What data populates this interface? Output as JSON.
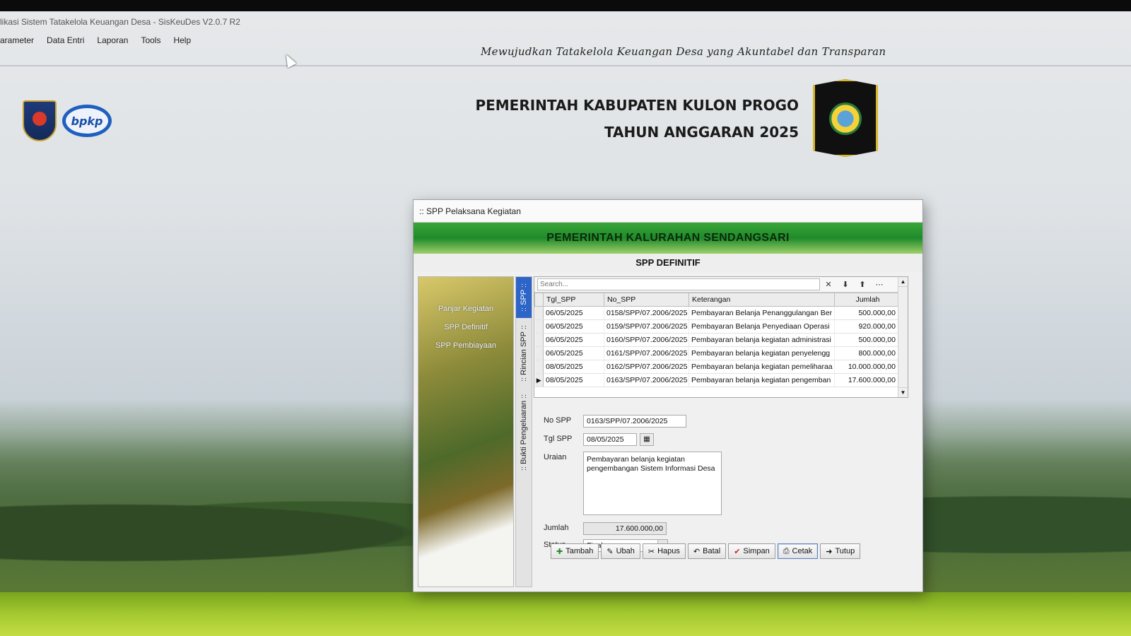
{
  "app": {
    "title": "likasi Sistem Tatakelola Keuangan Desa - SisKeuDes V2.0.7 R2",
    "menu": [
      "arameter",
      "Data Entri",
      "Laporan",
      "Tools",
      "Help"
    ],
    "motto": "Mewujudkan Tatakelola Keuangan Desa yang Akuntabel dan Transparan",
    "header_line1": "PEMERINTAH KABUPATEN KULON PROGO",
    "header_line2": "TAHUN ANGGARAN 2025",
    "bpkp_logo_text": "bpkp"
  },
  "window": {
    "title": ":: SPP Pelaksana Kegiatan",
    "banner": "PEMERINTAH KALURAHAN SENDANGSARI",
    "subtitle": "SPP DEFINITIF",
    "side_links": [
      "Panjar Kegiatan",
      "SPP Definitif",
      "SPP Pembiayaan"
    ],
    "tabs": [
      ":: SPP ::",
      ":: Rincian SPP ::",
      ":: Bukti Pengeluaran ::"
    ],
    "grid": {
      "search_placeholder": "Search...",
      "tools": [
        "✕",
        "⬇",
        "⬆",
        "⋯"
      ],
      "columns": [
        "Tgl_SPP",
        "No_SPP",
        "Keterangan",
        "Jumlah"
      ],
      "rows": [
        {
          "tgl": "06/05/2025",
          "no": "0158/SPP/07.2006/2025",
          "ket": "Pembayaran Belanja Penanggulangan Ber",
          "jumlah": "500.000,00"
        },
        {
          "tgl": "06/05/2025",
          "no": "0159/SPP/07.2006/2025",
          "ket": "Pembayaran Belanja Penyediaan Operasi",
          "jumlah": "920.000,00"
        },
        {
          "tgl": "06/05/2025",
          "no": "0160/SPP/07.2006/2025",
          "ket": "Pembayaran belanja kegiatan administrasi",
          "jumlah": "500.000,00"
        },
        {
          "tgl": "06/05/2025",
          "no": "0161/SPP/07.2006/2025",
          "ket": "Pembayaran belanja kegiatan penyelengg",
          "jumlah": "800.000,00"
        },
        {
          "tgl": "08/05/2025",
          "no": "0162/SPP/07.2006/2025",
          "ket": "Pembayaran belanja kegiatan pemeliharaa",
          "jumlah": "10.000.000,00"
        },
        {
          "tgl": "08/05/2025",
          "no": "0163/SPP/07.2006/2025",
          "ket": "Pembayaran belanja kegiatan pengemban",
          "jumlah": "17.600.000,00"
        }
      ],
      "selected_row": 5
    },
    "form": {
      "no_spp_label": "No SPP",
      "no_spp_value": "0163/SPP/07.2006/2025",
      "tgl_spp_label": "Tgl SPP",
      "tgl_spp_value": "08/05/2025",
      "uraian_label": "Uraian",
      "uraian_value": "Pembayaran belanja kegiatan pengembangan Sistem Informasi Desa",
      "jumlah_label": "Jumlah",
      "jumlah_value": "17.600.000,00",
      "status_label": "Status",
      "status_value": "Final"
    },
    "buttons": [
      "Tambah",
      "Ubah",
      "Hapus",
      "Batal",
      "Simpan",
      "Cetak",
      "Tutup"
    ]
  }
}
